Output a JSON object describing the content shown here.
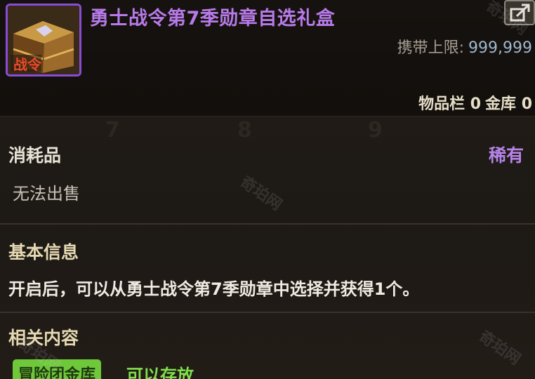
{
  "item": {
    "title": "勇士战令第7季勋章自选礼盒",
    "icon": "treasure-chest-icon",
    "icon_text": "战令",
    "title_color": "#b77ae8"
  },
  "carry_limit": {
    "label": "携带上限:",
    "value": "999,999"
  },
  "storage": {
    "inventory": "物品栏 0",
    "vault": "金库 0"
  },
  "category": "消耗品",
  "rarity": "稀有",
  "rarity_color": "#b784ea",
  "sell_status": "无法出售",
  "basic_info": {
    "title": "基本信息",
    "description": "开启后，可以从勇士战令第7季勋章中选择并获得1个。"
  },
  "related": {
    "title": "相关内容",
    "badge": "冒险团金库",
    "badge_color": "#6ec83a",
    "status": "可以存放"
  },
  "background_slots": [
    "7",
    "8",
    "9"
  ],
  "watermark": "奇珀网"
}
